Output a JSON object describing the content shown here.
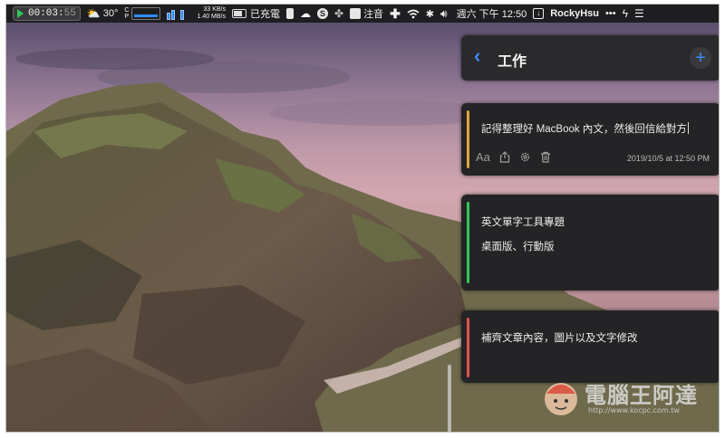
{
  "menubar": {
    "timer": "00:03",
    "timer_seconds": "55",
    "weather_icon": "sun-cloud-icon",
    "temperature": "30°",
    "net_up": "33 KB/s",
    "net_down": "1.40 MB/s",
    "battery_status": "已充電",
    "input_method": "注音",
    "datetime": "週六 下午 12:50",
    "username": "RockyHsu",
    "more": "•••"
  },
  "app": {
    "header": {
      "back_icon": "chevron-left-icon",
      "title": "工作",
      "add_icon": "plus-icon"
    },
    "notes": [
      {
        "text": "記得整理好 MacBook 內文，然後回信給對方",
        "timestamp": "2019/10/5 at 12:50 PM",
        "stripe_color": "#e0a53a",
        "toolbar": {
          "font_label": "Aa"
        }
      },
      {
        "line1": "英文單字工具專題",
        "line2": "桌面版、行動版",
        "stripe_color": "#34c759"
      },
      {
        "text": "補齊文章內容，圖片以及文字修改",
        "stripe_color": "#e0534a"
      }
    ]
  },
  "watermark": {
    "title": "電腦王阿達",
    "url": "http://www.kocpc.com.tw"
  }
}
